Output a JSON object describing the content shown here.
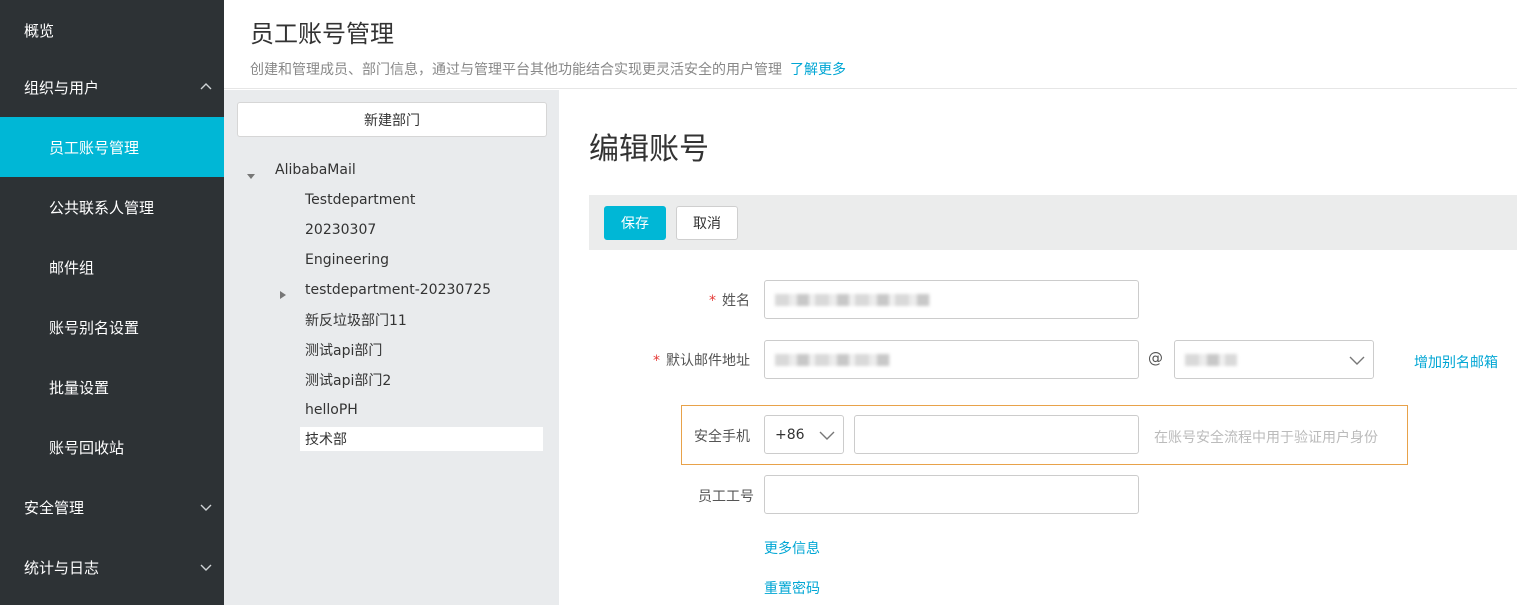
{
  "sidebar": {
    "items": [
      {
        "label": "概览",
        "level": "top"
      },
      {
        "label": "组织与用户",
        "level": "top",
        "chevron": "up"
      },
      {
        "label": "员工账号管理",
        "level": "sub",
        "active": true
      },
      {
        "label": "公共联系人管理",
        "level": "sub"
      },
      {
        "label": "邮件组",
        "level": "sub"
      },
      {
        "label": "账号别名设置",
        "level": "sub"
      },
      {
        "label": "批量设置",
        "level": "sub"
      },
      {
        "label": "账号回收站",
        "level": "sub"
      },
      {
        "label": "安全管理",
        "level": "top",
        "chevron": "down"
      },
      {
        "label": "统计与日志",
        "level": "top",
        "chevron": "down"
      }
    ]
  },
  "header": {
    "title": "员工账号管理",
    "description": "创建和管理成员、部门信息，通过与管理平台其他功能结合实现更灵活安全的用户管理",
    "learn_more": "了解更多"
  },
  "tree": {
    "new_department_label": "新建部门",
    "root": "AlibabaMail",
    "nodes": [
      {
        "label": "Testdepartment"
      },
      {
        "label": "20230307"
      },
      {
        "label": "Engineering"
      },
      {
        "label": "testdepartment-20230725",
        "collapsed": true
      },
      {
        "label": "新反垃圾部门11"
      },
      {
        "label": "测试api部门"
      },
      {
        "label": "测试api部门2"
      },
      {
        "label": "helloPH"
      },
      {
        "label": "技术部",
        "selected": true
      }
    ]
  },
  "form": {
    "title": "编辑账号",
    "save_label": "保存",
    "cancel_label": "取消",
    "required_mark": "*",
    "name_label": "姓名",
    "email_label": "默认邮件地址",
    "at_symbol": "@",
    "add_alias_label": "增加别名邮箱",
    "phone_label": "安全手机",
    "country_code": "+86",
    "phone_hint": "在账号安全流程中用于验证用户身份",
    "employee_id_label": "员工工号",
    "more_info_label": "更多信息",
    "reset_password_label": "重置密码"
  },
  "colors": {
    "sidebar_bg": "#2d3235",
    "accent": "#00b7d6",
    "link": "#00a6d4",
    "highlight_border": "#e8a24a",
    "required": "#e53935"
  }
}
